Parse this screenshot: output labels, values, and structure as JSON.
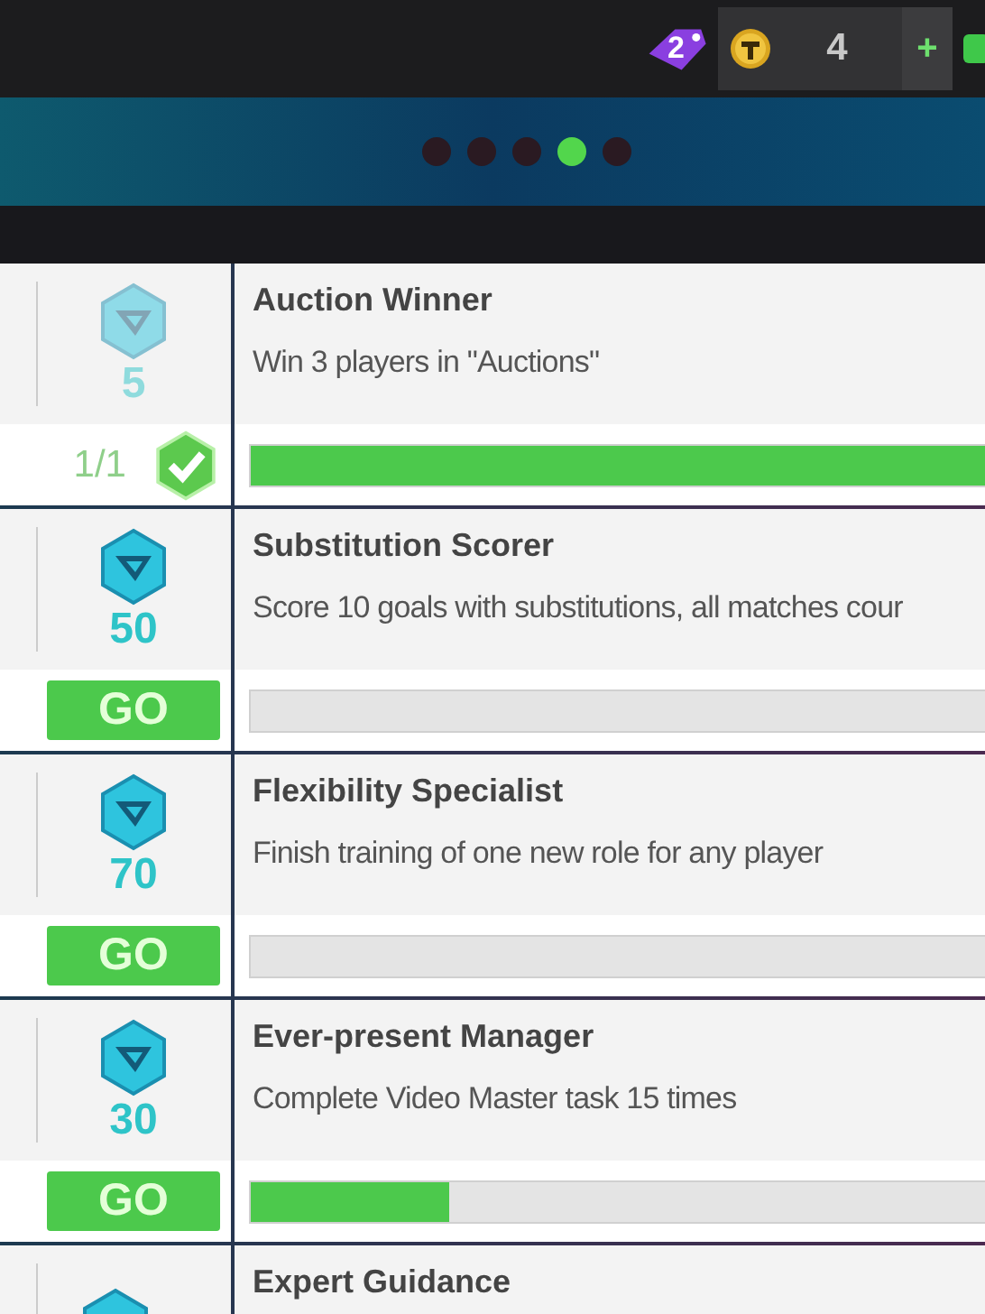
{
  "top_bar": {
    "tag_count": "2",
    "coins": "4",
    "add_label": "+"
  },
  "banner": {
    "dots": [
      {
        "selected": false
      },
      {
        "selected": false
      },
      {
        "selected": false
      },
      {
        "selected": true
      },
      {
        "selected": false
      }
    ]
  },
  "tasks": [
    {
      "title": "Auction Winner",
      "description": "Win 3 players in \"Auctions\"",
      "reward": "5",
      "completed": true,
      "progress": "1/1",
      "level": 1
    },
    {
      "title": "Substitution Scorer",
      "description": "Score 10 goals with substitutions, all matches cour",
      "reward": "50",
      "completed": false,
      "button": "GO"
    },
    {
      "title": "Flexibility Specialist",
      "description": "Finish training of one new role for any player",
      "reward": "70",
      "completed": false,
      "button": "GO"
    },
    {
      "title": "Ever-present Manager",
      "description": "Complete Video Master task 15 times",
      "reward": "30",
      "completed": false,
      "button": "GO",
      "level": 0.27
    },
    {
      "title": "Expert Guidance"
    }
  ]
}
